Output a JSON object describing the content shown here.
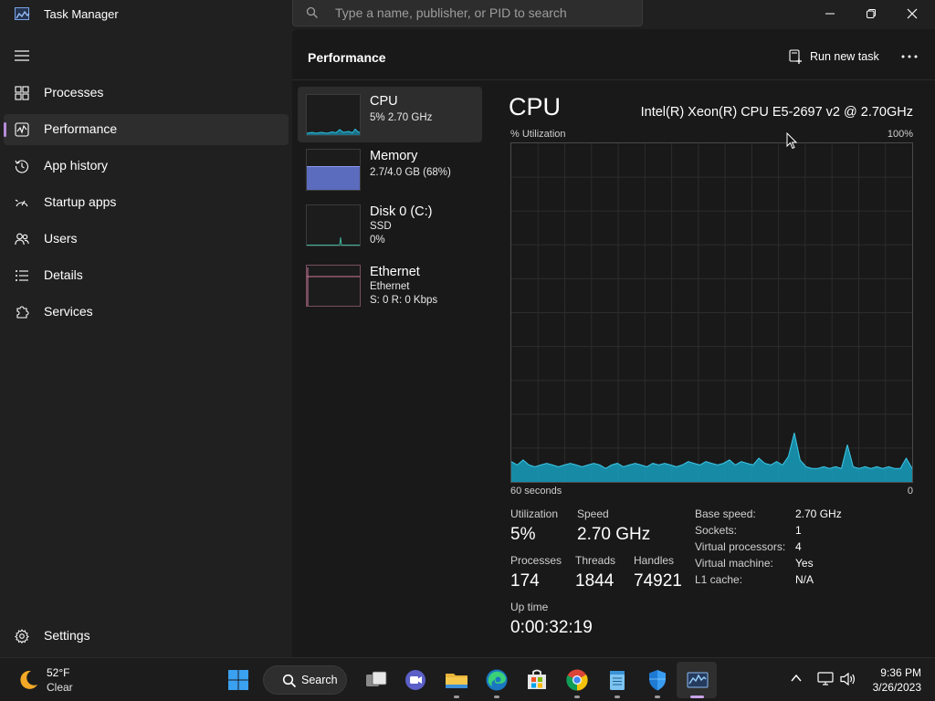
{
  "window": {
    "title": "Task Manager",
    "search_placeholder": "Type a name, publisher, or PID to search"
  },
  "sidebar": {
    "items": [
      {
        "label": "Processes",
        "icon": "processes-grid-icon"
      },
      {
        "label": "Performance",
        "icon": "performance-chart-icon",
        "active": true
      },
      {
        "label": "App history",
        "icon": "history-clock-icon"
      },
      {
        "label": "Startup apps",
        "icon": "startup-gauge-icon"
      },
      {
        "label": "Users",
        "icon": "users-icon"
      },
      {
        "label": "Details",
        "icon": "details-list-icon"
      },
      {
        "label": "Services",
        "icon": "services-puzzle-icon"
      }
    ],
    "settings_label": "Settings"
  },
  "header": {
    "title": "Performance",
    "run_new_task": "Run new task"
  },
  "resources": [
    {
      "name": "CPU",
      "line1": "5%  2.70 GHz",
      "line2": "",
      "active": true
    },
    {
      "name": "Memory",
      "line1": "2.7/4.0 GB (68%)",
      "line2": ""
    },
    {
      "name": "Disk 0 (C:)",
      "line1": "SSD",
      "line2": "0%"
    },
    {
      "name": "Ethernet",
      "line1": "Ethernet",
      "line2": "S: 0  R: 0 Kbps"
    }
  ],
  "cpu": {
    "title": "CPU",
    "model": "Intel(R) Xeon(R) CPU E5-2697 v2 @ 2.70GHz",
    "utilization_axis_label": "% Utilization",
    "axis_max_label": "100%",
    "time_left_label": "60 seconds",
    "time_right_label": "0",
    "graph_color": "#17a0bf",
    "history_percent": [
      6.0,
      5.0,
      6.5,
      5.0,
      4.5,
      5.0,
      5.5,
      5.0,
      4.5,
      5.0,
      5.5,
      5.0,
      4.5,
      5.0,
      5.5,
      5.0,
      4.0,
      5.0,
      5.5,
      4.5,
      5.0,
      5.5,
      5.0,
      4.5,
      5.5,
      5.0,
      5.5,
      5.0,
      4.5,
      5.0,
      6.0,
      5.5,
      5.0,
      6.0,
      5.5,
      5.0,
      5.5,
      6.5,
      5.0,
      6.0,
      5.5,
      5.0,
      7.0,
      5.5,
      5.0,
      6.0,
      5.0,
      7.5,
      14.5,
      6.5,
      4.5,
      4.0,
      4.0,
      4.5,
      4.0,
      4.5,
      4.0,
      11.0,
      4.5,
      4.0,
      4.5,
      4.0,
      4.5,
      4.0,
      4.5,
      4.0,
      4.0,
      7.0,
      4.0
    ],
    "stats": {
      "utilization_label": "Utilization",
      "utilization": "5%",
      "speed_label": "Speed",
      "speed": "2.70 GHz",
      "processes_label": "Processes",
      "processes": "174",
      "threads_label": "Threads",
      "threads": "1844",
      "handles_label": "Handles",
      "handles": "74921",
      "uptime_label": "Up time",
      "uptime": "0:00:32:19"
    },
    "specs": [
      {
        "key": "Base speed:",
        "value": "2.70 GHz"
      },
      {
        "key": "Sockets:",
        "value": "1"
      },
      {
        "key": "Virtual processors:",
        "value": "4"
      },
      {
        "key": "Virtual machine:",
        "value": "Yes"
      },
      {
        "key": "L1 cache:",
        "value": "N/A"
      }
    ]
  },
  "taskbar": {
    "weather_temp": "52°F",
    "weather_cond": "Clear",
    "search_label": "Search",
    "time": "9:36 PM",
    "date": "3/26/2023",
    "apps": [
      "start-icon",
      "task-view-icon",
      "chat-icon",
      "file-explorer-icon",
      "edge-icon",
      "store-icon",
      "chrome-icon",
      "notepad-icon",
      "defender-icon",
      "task-manager-icon"
    ]
  }
}
